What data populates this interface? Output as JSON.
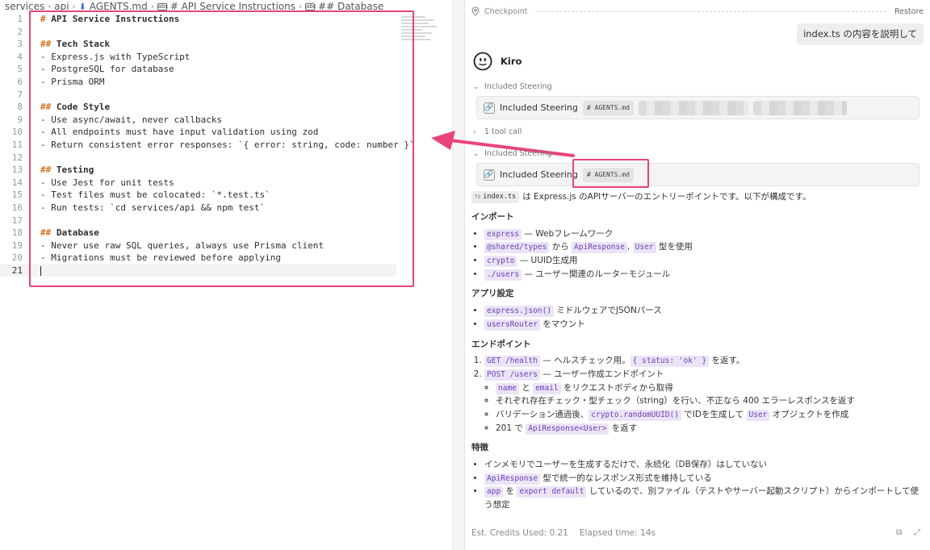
{
  "editor": {
    "breadcrumb": [
      "services",
      "api",
      "AGENTS.md",
      "# API Service Instructions",
      "## Database"
    ],
    "lines": [
      {
        "n": "1",
        "hash": "#",
        "text": " API Service Instructions",
        "kind": "h1"
      },
      {
        "n": "2",
        "hash": "",
        "text": "",
        "kind": ""
      },
      {
        "n": "3",
        "hash": "##",
        "text": " Tech Stack",
        "kind": "h2"
      },
      {
        "n": "4",
        "hash": "",
        "text": "- Express.js with TypeScript",
        "kind": ""
      },
      {
        "n": "5",
        "hash": "",
        "text": "- PostgreSQL for database",
        "kind": ""
      },
      {
        "n": "6",
        "hash": "",
        "text": "- Prisma ORM",
        "kind": ""
      },
      {
        "n": "7",
        "hash": "",
        "text": "",
        "kind": ""
      },
      {
        "n": "8",
        "hash": "##",
        "text": " Code Style",
        "kind": "h2"
      },
      {
        "n": "9",
        "hash": "",
        "text": "- Use async/await, never callbacks",
        "kind": ""
      },
      {
        "n": "10",
        "hash": "",
        "text": "- All endpoints must have input validation using zod",
        "kind": ""
      },
      {
        "n": "11",
        "hash": "",
        "text": "- Return consistent error responses: `{ error: string, code: number }`",
        "kind": ""
      },
      {
        "n": "12",
        "hash": "",
        "text": "",
        "kind": ""
      },
      {
        "n": "13",
        "hash": "##",
        "text": " Testing",
        "kind": "h2"
      },
      {
        "n": "14",
        "hash": "",
        "text": "- Use Jest for unit tests",
        "kind": ""
      },
      {
        "n": "15",
        "hash": "",
        "text": "- Test files must be colocated: `*.test.ts`",
        "kind": ""
      },
      {
        "n": "16",
        "hash": "",
        "text": "- Run tests: `cd services/api && npm test`",
        "kind": ""
      },
      {
        "n": "17",
        "hash": "",
        "text": "",
        "kind": ""
      },
      {
        "n": "18",
        "hash": "##",
        "text": " Database",
        "kind": "h2"
      },
      {
        "n": "19",
        "hash": "",
        "text": "- Never use raw SQL queries, always use Prisma client",
        "kind": ""
      },
      {
        "n": "20",
        "hash": "",
        "text": "- Migrations must be reviewed before applying",
        "kind": ""
      },
      {
        "n": "21",
        "hash": "",
        "text": "",
        "kind": "current"
      }
    ]
  },
  "chat": {
    "checkpoint_label": "Checkpoint",
    "restore_label": "Restore",
    "user_message": "index.ts の内容を説明して",
    "agent_name": "Kiro",
    "steering_toggle_1": "Included Steering",
    "steering_label": "Included Steering",
    "agents_chip": "AGENTS.md",
    "tool_call_toggle": "1 tool call",
    "steering_toggle_2": "Included Steering",
    "intro_file": "index.ts",
    "intro_file_badge": "TS",
    "intro_text": "は Express.js のAPIサーバーのエントリーポイントです。以下が構成です。",
    "sections": {
      "imports_title": "インポート",
      "imports": [
        {
          "code": "express",
          "text": " — Webフレームワーク"
        },
        {
          "code": "@shared/types",
          "mid": " から ",
          "code2": "ApiResponse",
          "mid2": ", ",
          "code3": "User",
          "text": " 型を使用"
        },
        {
          "code": "crypto",
          "text": " — UUID生成用"
        },
        {
          "code": "./users",
          "text": " — ユーザー関連のルーターモジュール"
        }
      ],
      "app_title": "アプリ設定",
      "app": [
        {
          "code": "express.json()",
          "text": " ミドルウェアでJSONパース"
        },
        {
          "code": "usersRouter",
          "text": " をマウント"
        }
      ],
      "endpoints_title": "エンドポイント",
      "ep1_code": "GET /health",
      "ep1_text": " — ヘルスチェック用。",
      "ep1_code2": "{ status: 'ok' }",
      "ep1_text2": " を返す。",
      "ep2_code": "POST /users",
      "ep2_text": " — ユーザー作成エンドポイント",
      "ep2_sub1_code": "name",
      "ep2_sub1_mid": " と ",
      "ep2_sub1_code2": "email",
      "ep2_sub1_text": " をリクエストボディから取得",
      "ep2_sub2_text": "それぞれ存在チェック・型チェック（string）を行い、不正なら 400 エラーレスポンスを返す",
      "ep2_sub3_pre": "バリデーション通過後、",
      "ep2_sub3_code": "crypto.randomUUID()",
      "ep2_sub3_mid": " でIDを生成して ",
      "ep2_sub3_code2": "User",
      "ep2_sub3_text": " オブジェクトを作成",
      "ep2_sub4_pre": "201 で ",
      "ep2_sub4_code": "ApiResponse<User>",
      "ep2_sub4_text": " を返す",
      "features_title": "特徴",
      "feat1_text": "インメモリでユーザーを生成するだけで、永続化（DB保存）はしていない",
      "feat2_code": "ApiResponse",
      "feat2_text": " 型で統一的なレスポンス形式を維持している",
      "feat3_code": "app",
      "feat3_mid": " を ",
      "feat3_code2": "export default",
      "feat3_text": " しているので、別ファイル（テストやサーバー起動スクリプト）からインポートして使う想定"
    },
    "footer_credits": "Est. Credits Used: 0.21",
    "footer_elapsed": "Elapsed time: 14s"
  },
  "colors": {
    "highlight": "#e8447a",
    "code_bg": "#ebe4f7",
    "code_fg": "#6a3fb4",
    "heading_hash": "#d5731f"
  }
}
